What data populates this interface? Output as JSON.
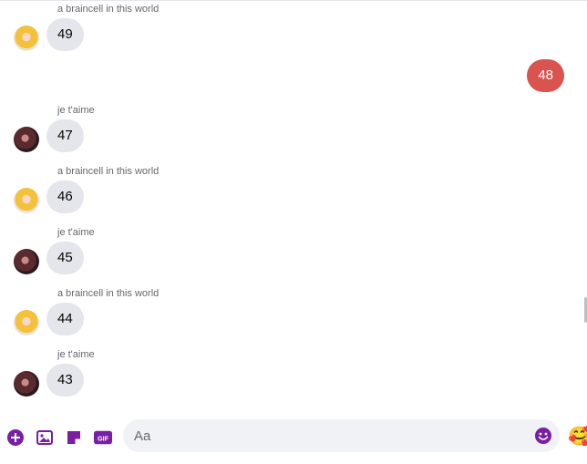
{
  "messages": [
    {
      "sender": "a braincell in this world",
      "text": "49",
      "direction": "received",
      "avatar": "avatar-yellow"
    },
    {
      "sender": "",
      "text": "48",
      "direction": "sent"
    },
    {
      "sender": "je t'aime",
      "text": "47",
      "direction": "received",
      "avatar": "avatar-dark"
    },
    {
      "sender": "a braincell in this world",
      "text": "46",
      "direction": "received",
      "avatar": "avatar-yellow"
    },
    {
      "sender": "je t'aime",
      "text": "45",
      "direction": "received",
      "avatar": "avatar-dark"
    },
    {
      "sender": "a braincell in this world",
      "text": "44",
      "direction": "received",
      "avatar": "avatar-yellow"
    },
    {
      "sender": "je t'aime",
      "text": "43",
      "direction": "received",
      "avatar": "avatar-dark"
    }
  ],
  "composer": {
    "placeholder": "Aa",
    "tools": [
      "plus-circle-icon",
      "image-icon",
      "sticker-icon",
      "gif-icon"
    ],
    "gif_label": "GIF",
    "emoji_icon": "smiley-icon",
    "reaction_emoji": "🥰"
  },
  "colors": {
    "accent": "#7a1fa2",
    "sent_bubble": "#d9534f",
    "received_bubble": "#e4e6eb"
  }
}
